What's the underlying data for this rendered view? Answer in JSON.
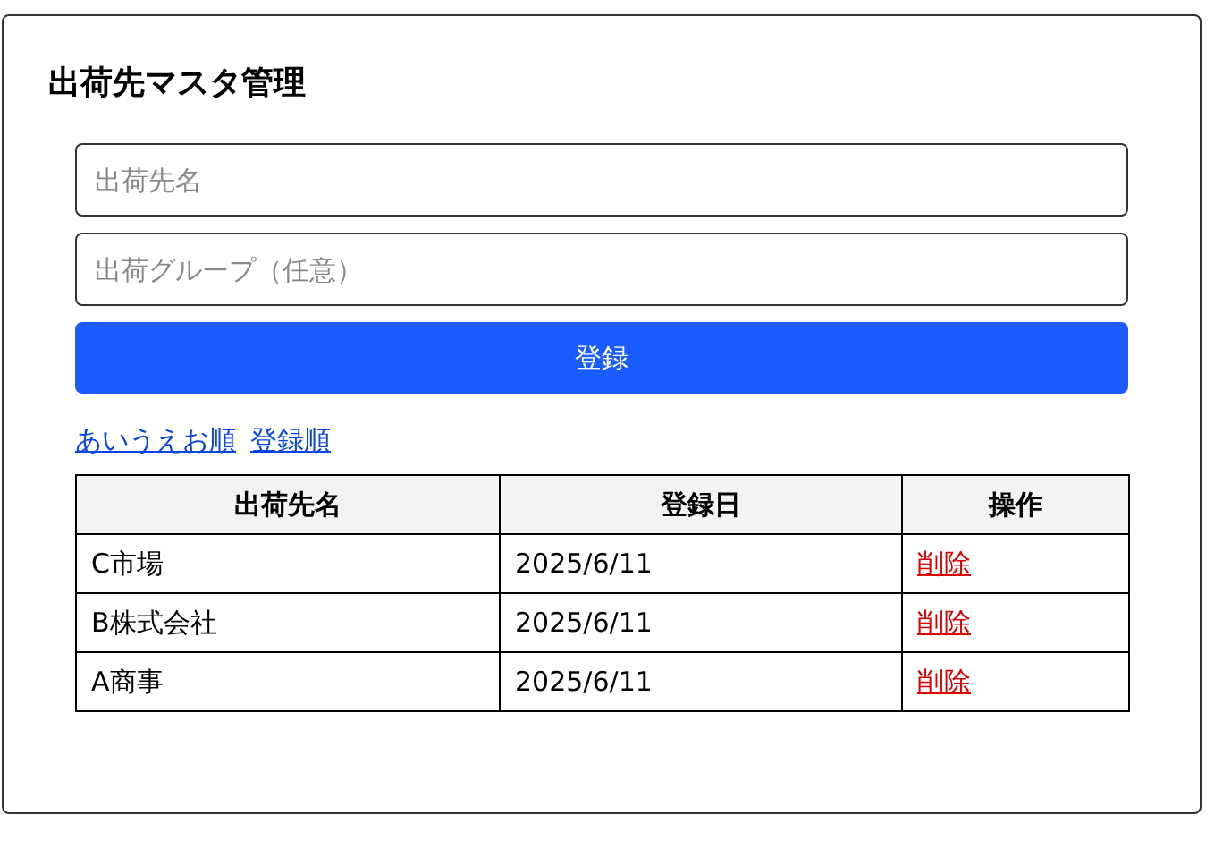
{
  "title": "出荷先マスタ管理",
  "form": {
    "name_field": {
      "placeholder": "出荷先名"
    },
    "group_field": {
      "placeholder": "出荷グループ（任意）"
    },
    "submit": "登録"
  },
  "sort_links": [
    "あいうえお順",
    "登録順"
  ],
  "table": {
    "columns": [
      "出荷先名",
      "登録日",
      "操作"
    ],
    "rows": [
      {
        "name": "C市場",
        "date": "2025/6/11",
        "action": "削除"
      },
      {
        "name": "B株式会社",
        "date": "2025/6/11",
        "action": "削除"
      },
      {
        "name": "A商事",
        "date": "2025/6/11",
        "action": "削除"
      }
    ]
  }
}
